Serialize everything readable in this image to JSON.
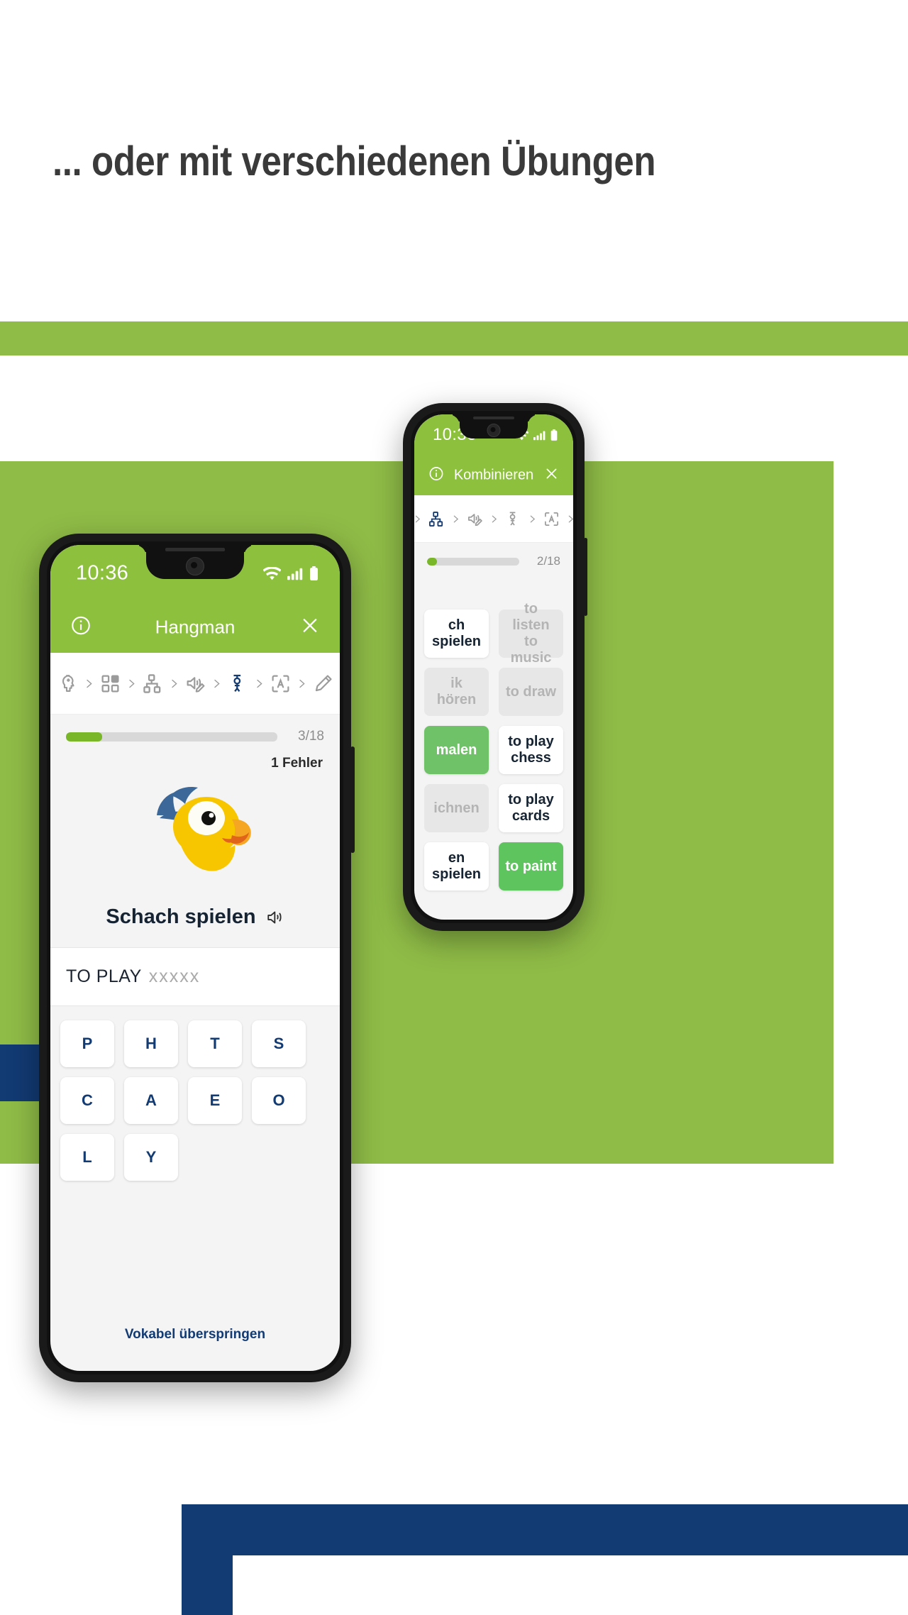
{
  "page": {
    "headline": "... oder mit verschiedenen Übungen",
    "colors": {
      "green": "#8cc03d",
      "band_green": "#8fbc47",
      "navy": "#123a73",
      "progress_green": "#79b728",
      "correct_green": "#6fc268",
      "screen_bg": "#f4f4f4"
    }
  },
  "back_phone": {
    "status": {
      "time": "10:36",
      "icons": [
        "wifi-icon",
        "signal-icon",
        "battery-icon"
      ]
    },
    "appbar": {
      "info_icon": "info-icon",
      "title": "Kombinieren",
      "close_icon": "close-icon"
    },
    "breadcrumb": {
      "icons": [
        "grid-icon",
        "hierarchy-icon",
        "speaker-write-icon",
        "hangman-icon",
        "scan-text-icon",
        "pencil-icon"
      ],
      "active_index": -1
    },
    "progress": {
      "value": 2,
      "total": 18,
      "label": "2/18",
      "percent": 11
    },
    "left_column": [
      {
        "label": "ch spielen",
        "state": "white"
      },
      {
        "label": "ik hören",
        "state": "muted"
      },
      {
        "label": "malen",
        "state": "green"
      },
      {
        "label": "ichnen",
        "state": "muted"
      },
      {
        "label": "en spielen",
        "state": "white"
      }
    ],
    "right_column": [
      {
        "label": "to listen to music",
        "state": "muted"
      },
      {
        "label": "to draw",
        "state": "muted"
      },
      {
        "label": "to play chess",
        "state": "white"
      },
      {
        "label": "to play cards",
        "state": "white"
      },
      {
        "label": "to paint",
        "state": "green"
      }
    ]
  },
  "front_phone": {
    "status": {
      "time": "10:36",
      "icons": [
        "wifi-icon",
        "signal-icon",
        "battery-icon"
      ]
    },
    "appbar": {
      "info_icon": "info-icon",
      "title": "Hangman",
      "close_icon": "close-icon"
    },
    "breadcrumb": {
      "icons": [
        "head-plus-icon",
        "grid-icon",
        "hierarchy-icon",
        "speaker-write-icon",
        "hangman-icon",
        "scan-text-icon",
        "pencil-icon"
      ],
      "active_icon": "hangman-icon"
    },
    "progress": {
      "value": 3,
      "total": 18,
      "label": "3/18",
      "percent": 17
    },
    "errors_label": "1 Fehler",
    "mascot": "parrot-mascot",
    "prompt": {
      "word": "Schach spielen",
      "speaker_icon": "speaker-icon"
    },
    "answer": {
      "solved": "TO PLAY",
      "blanks": "xxxxx"
    },
    "keys": [
      "P",
      "H",
      "T",
      "S",
      "C",
      "A",
      "E",
      "O",
      "L",
      "Y"
    ],
    "skip_label": "Vokabel überspringen"
  }
}
